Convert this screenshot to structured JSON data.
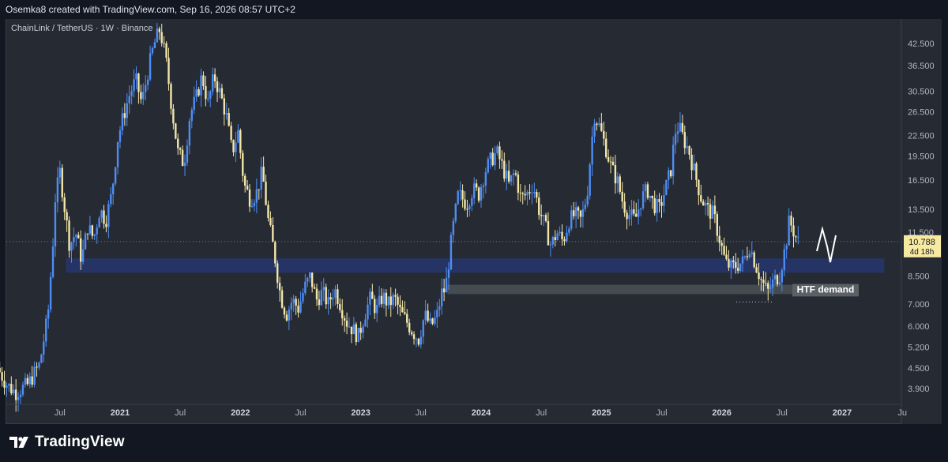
{
  "header": {
    "attribution": "Osemka8 created with TradingView.com, Sep 16, 2026 08:57 UTC+2"
  },
  "chart_info": {
    "symbol_line": "ChainLink / TetherUS · 1W · Binance"
  },
  "footer": {
    "brand": "TradingView"
  },
  "colors": {
    "background": "#262a33",
    "up_candle": "#4e8df5",
    "down_candle": "#f2e6a8",
    "demand_zone": "#26356a",
    "htf_zone": "#4a5157",
    "price_label_bg": "#f7e9a0"
  },
  "chart_data": {
    "type": "candlestick",
    "scale": "log",
    "y_ticks": [
      {
        "value": 3.9,
        "label": "3.900"
      },
      {
        "value": 4.5,
        "label": "4.500"
      },
      {
        "value": 5.2,
        "label": "5.200"
      },
      {
        "value": 6.0,
        "label": "6.000"
      },
      {
        "value": 7.0,
        "label": "7.000"
      },
      {
        "value": 8.5,
        "label": "8.500"
      },
      {
        "value": 11.5,
        "label": "11.500"
      },
      {
        "value": 13.5,
        "label": "13.500"
      },
      {
        "value": 16.5,
        "label": "16.500"
      },
      {
        "value": 19.5,
        "label": "19.500"
      },
      {
        "value": 22.5,
        "label": "22.500"
      },
      {
        "value": 26.5,
        "label": "26.500"
      },
      {
        "value": 30.5,
        "label": "30.500"
      },
      {
        "value": 36.5,
        "label": "36.500"
      },
      {
        "value": 42.5,
        "label": "42.500"
      }
    ],
    "x_ticks": [
      {
        "label": "Jul",
        "t": 2020.5,
        "bold": false
      },
      {
        "label": "2021",
        "t": 2021.0,
        "bold": true
      },
      {
        "label": "Jul",
        "t": 2021.5,
        "bold": false
      },
      {
        "label": "2022",
        "t": 2022.0,
        "bold": true
      },
      {
        "label": "Jul",
        "t": 2022.5,
        "bold": false
      },
      {
        "label": "2023",
        "t": 2023.0,
        "bold": true
      },
      {
        "label": "Jul",
        "t": 2023.5,
        "bold": false
      },
      {
        "label": "2024",
        "t": 2024.0,
        "bold": true
      },
      {
        "label": "Jul",
        "t": 2024.5,
        "bold": false
      },
      {
        "label": "2025",
        "t": 2025.0,
        "bold": true
      },
      {
        "label": "Jul",
        "t": 2025.5,
        "bold": false
      },
      {
        "label": "2026",
        "t": 2026.0,
        "bold": true
      },
      {
        "label": "Jul",
        "t": 2026.5,
        "bold": false
      },
      {
        "label": "2027",
        "t": 2027.0,
        "bold": true
      },
      {
        "label": "Ju",
        "t": 2027.5,
        "bold": false
      }
    ],
    "current_price": {
      "value": 10.788,
      "label": "10.788",
      "countdown": "4d 18h"
    },
    "zones": [
      {
        "name": "demand-zone",
        "label": "",
        "t1": 2020.55,
        "t2": 2027.35,
        "low": 8.7,
        "high": 9.6
      },
      {
        "name": "htf-demand-zone",
        "label": "HTF demand",
        "t1": 2023.72,
        "t2": 2027.13,
        "low": 7.5,
        "high": 8.0
      }
    ],
    "price_path": [
      [
        2020.0,
        4.5
      ],
      [
        2020.08,
        4.0
      ],
      [
        2020.15,
        3.8
      ],
      [
        2020.25,
        4.0
      ],
      [
        2020.35,
        4.6
      ],
      [
        2020.42,
        6.5
      ],
      [
        2020.46,
        10.5
      ],
      [
        2020.48,
        14.5
      ],
      [
        2020.52,
        17.5
      ],
      [
        2020.56,
        13.5
      ],
      [
        2020.6,
        10.5
      ],
      [
        2020.65,
        11.5
      ],
      [
        2020.7,
        9.5
      ],
      [
        2020.75,
        12.0
      ],
      [
        2020.8,
        11.0
      ],
      [
        2020.85,
        13.5
      ],
      [
        2020.9,
        12.5
      ],
      [
        2020.95,
        15.0
      ],
      [
        2021.0,
        22.0
      ],
      [
        2021.05,
        26.0
      ],
      [
        2021.1,
        30.0
      ],
      [
        2021.15,
        33.0
      ],
      [
        2021.2,
        28.0
      ],
      [
        2021.25,
        35.0
      ],
      [
        2021.3,
        42.0
      ],
      [
        2021.35,
        47.0
      ],
      [
        2021.4,
        38.0
      ],
      [
        2021.45,
        27.0
      ],
      [
        2021.5,
        20.0
      ],
      [
        2021.55,
        18.5
      ],
      [
        2021.6,
        26.0
      ],
      [
        2021.65,
        29.0
      ],
      [
        2021.7,
        34.0
      ],
      [
        2021.75,
        28.0
      ],
      [
        2021.8,
        34.0
      ],
      [
        2021.85,
        30.0
      ],
      [
        2021.9,
        26.0
      ],
      [
        2021.95,
        20.0
      ],
      [
        2022.0,
        23.0
      ],
      [
        2022.05,
        16.0
      ],
      [
        2022.1,
        14.5
      ],
      [
        2022.15,
        15.0
      ],
      [
        2022.2,
        17.5
      ],
      [
        2022.25,
        12.5
      ],
      [
        2022.3,
        10.0
      ],
      [
        2022.35,
        7.5
      ],
      [
        2022.4,
        6.5
      ],
      [
        2022.45,
        7.2
      ],
      [
        2022.5,
        6.8
      ],
      [
        2022.55,
        7.8
      ],
      [
        2022.6,
        8.5
      ],
      [
        2022.65,
        7.2
      ],
      [
        2022.7,
        7.6
      ],
      [
        2022.75,
        7.0
      ],
      [
        2022.8,
        7.8
      ],
      [
        2022.85,
        7.0
      ],
      [
        2022.9,
        6.2
      ],
      [
        2022.95,
        5.9
      ],
      [
        2023.0,
        5.6
      ],
      [
        2023.05,
        6.5
      ],
      [
        2023.1,
        7.3
      ],
      [
        2023.15,
        6.7
      ],
      [
        2023.2,
        7.4
      ],
      [
        2023.25,
        7.0
      ],
      [
        2023.3,
        7.3
      ],
      [
        2023.35,
        6.6
      ],
      [
        2023.4,
        6.2
      ],
      [
        2023.45,
        5.8
      ],
      [
        2023.5,
        5.5
      ],
      [
        2023.55,
        6.5
      ],
      [
        2023.6,
        6.0
      ],
      [
        2023.65,
        6.4
      ],
      [
        2023.7,
        7.8
      ],
      [
        2023.72,
        7.6
      ],
      [
        2023.78,
        11.5
      ],
      [
        2023.83,
        15.0
      ],
      [
        2023.9,
        14.0
      ],
      [
        2023.95,
        15.5
      ],
      [
        2024.0,
        15.0
      ],
      [
        2024.05,
        17.5
      ],
      [
        2024.1,
        19.0
      ],
      [
        2024.15,
        20.0
      ],
      [
        2024.2,
        18.0
      ],
      [
        2024.25,
        16.0
      ],
      [
        2024.3,
        17.5
      ],
      [
        2024.35,
        14.5
      ],
      [
        2024.4,
        15.0
      ],
      [
        2024.45,
        16.0
      ],
      [
        2024.5,
        13.5
      ],
      [
        2024.55,
        12.0
      ],
      [
        2024.6,
        10.5
      ],
      [
        2024.65,
        11.5
      ],
      [
        2024.7,
        10.8
      ],
      [
        2024.75,
        12.5
      ],
      [
        2024.8,
        13.0
      ],
      [
        2024.85,
        12.5
      ],
      [
        2024.9,
        15.0
      ],
      [
        2024.93,
        20.0
      ],
      [
        2024.96,
        26.0
      ],
      [
        2025.0,
        24.0
      ],
      [
        2025.05,
        21.0
      ],
      [
        2025.1,
        18.0
      ],
      [
        2025.15,
        16.5
      ],
      [
        2025.2,
        14.0
      ],
      [
        2025.25,
        13.0
      ],
      [
        2025.3,
        12.5
      ],
      [
        2025.35,
        14.5
      ],
      [
        2025.4,
        15.5
      ],
      [
        2025.45,
        14.0
      ],
      [
        2025.5,
        13.5
      ],
      [
        2025.55,
        15.5
      ],
      [
        2025.6,
        18.0
      ],
      [
        2025.63,
        23.0
      ],
      [
        2025.66,
        24.0
      ],
      [
        2025.7,
        22.0
      ],
      [
        2025.75,
        20.0
      ],
      [
        2025.8,
        17.0
      ],
      [
        2025.85,
        14.5
      ],
      [
        2025.9,
        13.5
      ],
      [
        2025.95,
        13.0
      ],
      [
        2026.0,
        11.0
      ],
      [
        2026.05,
        9.3
      ],
      [
        2026.1,
        9.0
      ],
      [
        2026.15,
        9.2
      ],
      [
        2026.2,
        9.4
      ],
      [
        2026.25,
        10.5
      ],
      [
        2026.3,
        9.2
      ],
      [
        2026.35,
        8.2
      ],
      [
        2026.4,
        7.6
      ],
      [
        2026.45,
        8.2
      ],
      [
        2026.5,
        8.6
      ],
      [
        2026.55,
        10.5
      ],
      [
        2026.58,
        12.5
      ],
      [
        2026.62,
        11.5
      ],
      [
        2026.65,
        10.8
      ]
    ]
  }
}
